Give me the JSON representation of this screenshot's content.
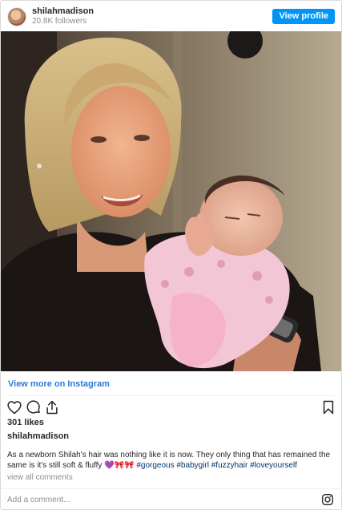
{
  "header": {
    "username": "shilahmadison",
    "followers": "20.8K followers",
    "view_profile_label": "View profile"
  },
  "post": {
    "view_more_label": "View more on Instagram",
    "likes": "301 likes",
    "author": "shilahmadison",
    "caption_text": "As a newborn Shilah's hair was nothing like it is now. They only thing that has remained the same is it's still soft & fluffy 💜🎀🎀",
    "hashtags": "#gorgeous #babygirl #fuzzyhair #loveyourself",
    "view_comments_label": "view all comments"
  },
  "footer": {
    "comment_placeholder": "Add a comment..."
  },
  "icons": {
    "like": "heart-outline-icon",
    "comment": "comment-bubble-icon",
    "share": "share-icon",
    "save": "bookmark-icon",
    "brand": "instagram-icon"
  },
  "colors": {
    "accent": "#0095f6",
    "link": "#2a7bd6",
    "hashtag": "#00376b",
    "muted": "#8e8e8e"
  }
}
